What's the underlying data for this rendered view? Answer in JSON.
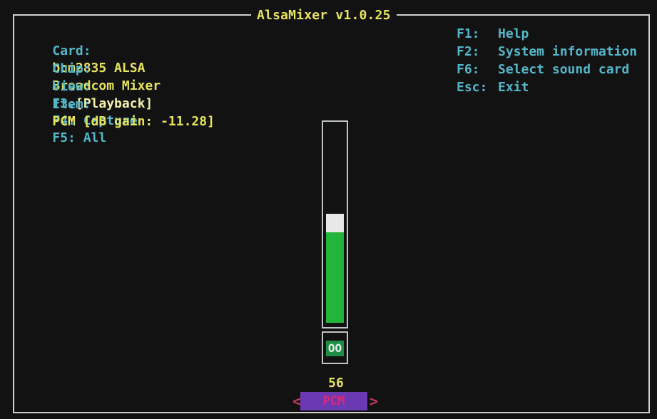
{
  "app": {
    "title": "AlsaMixer v1.0.25"
  },
  "info": {
    "card_label": "Card:",
    "card_value": "bcm2835 ALSA",
    "chip_label": "Chip:",
    "chip_value": "Broadcom Mixer",
    "view_label": "View:",
    "view_f3": "F3:",
    "view_playback": "[Playback]",
    "view_capture": "F4: Capture",
    "view_all": "F5: All",
    "item_label": "Item:",
    "item_value": "PCM [dB gain: -11.28]"
  },
  "keys": [
    {
      "key": "F1:",
      "label": "Help"
    },
    {
      "key": "F2:",
      "label": "System information"
    },
    {
      "key": "F6:",
      "label": "Select sound card"
    },
    {
      "key": "Esc:",
      "label": "Exit"
    }
  ],
  "control": {
    "name": "PCM",
    "value": "56",
    "mute_state": "OO",
    "level_fraction": 0.56,
    "left_arrow": "<",
    "right_arrow": ">"
  },
  "colors": {
    "bar_green": "#22b43b",
    "header_yellow": "#e5e35a",
    "header_cyan": "#52b7c9",
    "label_purple": "#6b39b1"
  }
}
